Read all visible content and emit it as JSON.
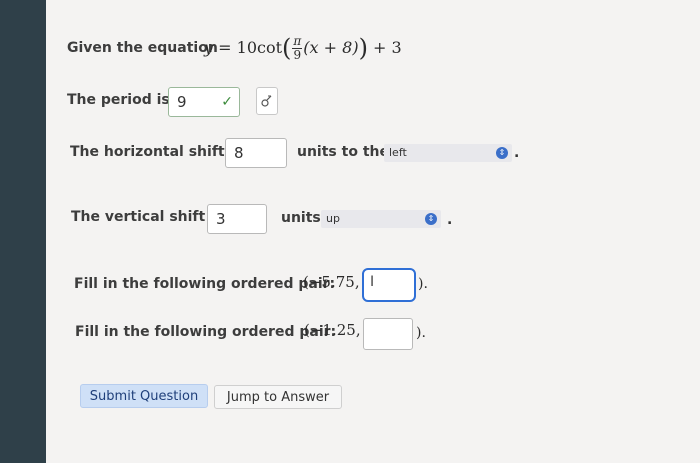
{
  "equation": {
    "intro": "Given the equation",
    "y": "y",
    "equals": "=",
    "coef": "10",
    "func": "cot",
    "frac_num": "π",
    "frac_den": "9",
    "inner": "(x + 8)",
    "tail": "+ 3"
  },
  "period": {
    "label": "The period is:",
    "value": "9",
    "check": "✓",
    "icon": "checkmark-icon",
    "tool_icon": "sigma-symbol-icon"
  },
  "horizontal": {
    "label": "The horizontal shift is",
    "value": "8",
    "units_label": "units to the",
    "direction": "left",
    "dropdown_icon": "chevron-updown-icon",
    "period": "."
  },
  "vertical": {
    "label": "The vertical shift is",
    "value": "3",
    "units_label": "units",
    "direction": "up",
    "dropdown_icon": "chevron-updown-icon",
    "period": "."
  },
  "pair1": {
    "label": "Fill in the following ordered pair:",
    "open": "(",
    "x": "−5.75,",
    "close": ").",
    "value": "",
    "cursor_icon": "text-cursor-icon"
  },
  "pair2": {
    "label": "Fill in the following ordered pair:",
    "open": "(",
    "x": "−1.25,",
    "close": ").",
    "value": ""
  },
  "buttons": {
    "submit": "Submit Question",
    "jump": "Jump to Answer"
  },
  "colors": {
    "accent": "#2f6fd6",
    "check": "#3a8a3a",
    "submit_bg": "#cfe0f7"
  }
}
